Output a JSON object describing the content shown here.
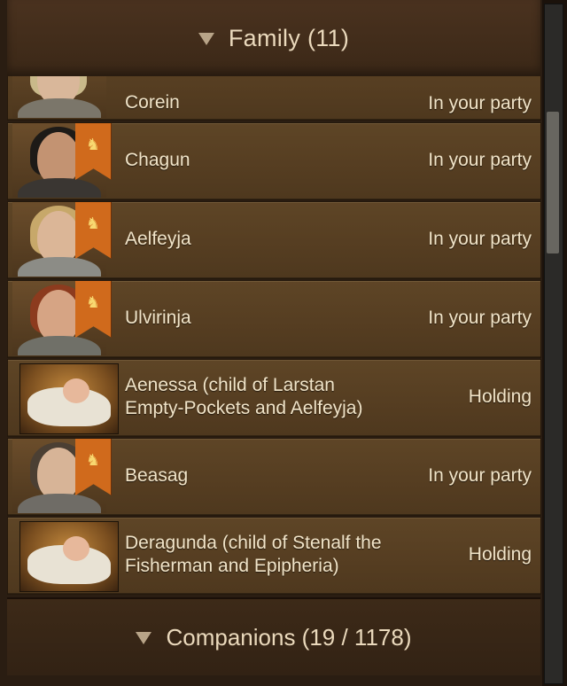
{
  "family_header": {
    "label": "Family (11)"
  },
  "members": [
    {
      "name": "Corein",
      "status": "In your party",
      "portrait": "woman-blonde",
      "banner": true
    },
    {
      "name": "Chagun",
      "status": "In your party",
      "portrait": "woman-dark-hair",
      "banner": true
    },
    {
      "name": "Aelfeyja",
      "status": "In your party",
      "portrait": "woman-blonde-armored",
      "banner": true
    },
    {
      "name": "Ulvirinja",
      "status": "In your party",
      "portrait": "woman-red-hair-armored",
      "banner": true
    },
    {
      "name": "Aenessa (child of Larstan Empty-Pockets and Aelfeyja)",
      "status": "Holding",
      "portrait": "baby",
      "banner": false
    },
    {
      "name": "Beasag",
      "status": "In your party",
      "portrait": "woman-brown-hair",
      "banner": true
    },
    {
      "name": "Deragunda (child of Stenalf the Fisherman and Epipheria)",
      "status": "Holding",
      "portrait": "baby",
      "banner": false
    }
  ],
  "companions_header": {
    "label": "Companions (19 / 1178)"
  },
  "banner_icon": "horse-icon",
  "colors": {
    "banner": "#d06a1c",
    "horse": "#f8d870",
    "text": "#f1e4c8"
  }
}
